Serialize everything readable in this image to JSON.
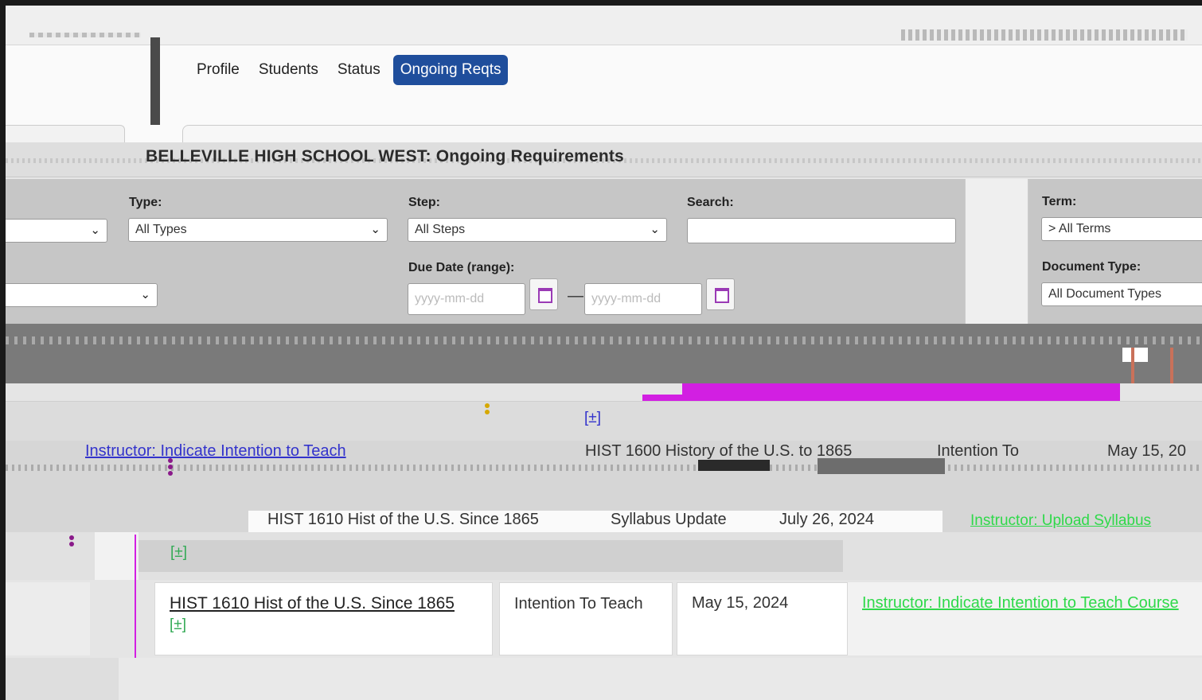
{
  "nav": {
    "tabs": [
      {
        "label": "Profile"
      },
      {
        "label": "Students"
      },
      {
        "label": "Status"
      },
      {
        "label": "Ongoing Reqts",
        "active": true
      }
    ]
  },
  "page": {
    "title": "BELLEVILLE HIGH SCHOOL WEST: Ongoing Requirements"
  },
  "filters": {
    "type_label": "Type:",
    "type_value": "All Types",
    "step_label": "Step:",
    "step_value": "All Steps",
    "search_label": "Search:",
    "search_value": "",
    "term_label": "Term:",
    "term_value": "> All Terms",
    "due_label": "Due Date (range):",
    "due_from_placeholder": "yyyy-mm-dd",
    "due_to_placeholder": "yyyy-mm-dd",
    "dash": "—",
    "doctype_label": "Document Type:",
    "doctype_value": "All Document Types"
  },
  "rows": {
    "r1_toggle": "[±]",
    "r2_link": "Instructor: Indicate Intention to Teach",
    "r2_course": "HIST 1600 History of the U.S. to 1865",
    "r2_step": "Intention To",
    "r2_date": "May 15, 20",
    "r3_course": "HIST 1610 Hist of the U.S. Since 1865",
    "r3_step": "Syllabus Update",
    "r3_date": "July 26, 2024",
    "r3_link": "Instructor: Upload Syllabus",
    "r4_toggle": "[±]",
    "r4_course": "HIST 1610 Hist of the U.S. Since 1865",
    "r4_toggle2": "[±]",
    "r4_step": "Intention To Teach",
    "r4_date": "May 15, 2024",
    "r4_link": "Instructor: Indicate Intention to Teach Course"
  },
  "colors": {
    "accent": "#1f4e9c",
    "link_green": "#2fd94a",
    "artifact_magenta": "#d21fe2"
  }
}
